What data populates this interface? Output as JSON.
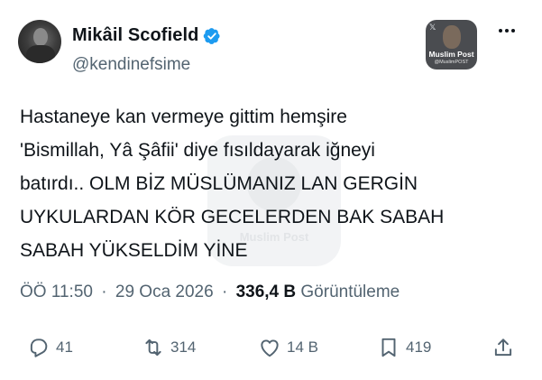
{
  "author": {
    "display_name": "Mikâil Scofield",
    "handle": "@kendinefsime",
    "verified": true
  },
  "media_badge": {
    "title": "Muslim Post",
    "subtitle": "@MuslimPOST"
  },
  "tweet": {
    "lines": [
      "Hastaneye kan vermeye gittim hemşire",
      "'Bismillah, Yâ Şâfii' diye fısıldayarak iğneyi",
      "batırdı.. OLM BİZ MÜSLÜMANIZ LAN GERGİN",
      "UYKULARDAN KÖR GECELERDEN BAK SABAH",
      "SABAH YÜKSELDİM YİNE"
    ]
  },
  "meta": {
    "time": "ÖÖ 11:50",
    "date": "29 Oca 2026",
    "views_count": "336,4 B",
    "views_label": "Görüntüleme",
    "separator": "·"
  },
  "actions": {
    "replies": "41",
    "reposts": "314",
    "likes": "14 B",
    "bookmarks": "419"
  },
  "colors": {
    "text": "#0f1419",
    "secondary": "#536471",
    "verified": "#1d9bf0"
  }
}
